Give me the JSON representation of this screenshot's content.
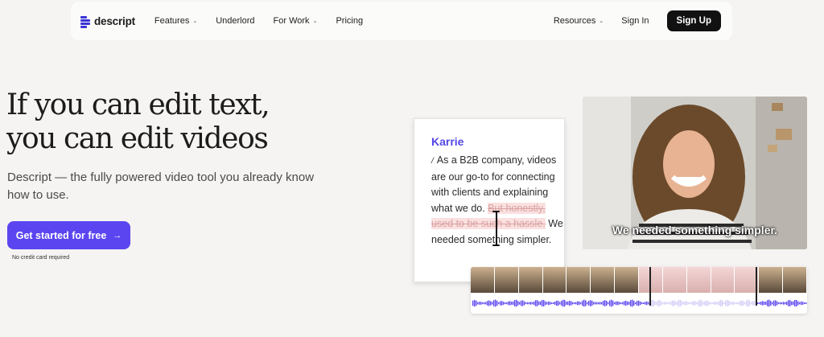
{
  "nav": {
    "brand": "descript",
    "left_items": [
      {
        "label": "Features",
        "dropdown": true
      },
      {
        "label": "Underlord",
        "dropdown": false
      },
      {
        "label": "For Work",
        "dropdown": true
      },
      {
        "label": "Pricing",
        "dropdown": false
      }
    ],
    "resources_label": "Resources",
    "signin_label": "Sign In",
    "signup_label": "Sign Up"
  },
  "hero": {
    "headline_line1": "If you can edit text,",
    "headline_line2": "you can edit videos",
    "subtext": "Descript — the fully powered video tool you already know how to use.",
    "cta_label": "Get started for free",
    "cta_arrow": "→",
    "note": "No credit card required"
  },
  "transcript": {
    "speaker": "Karrie",
    "marker": "/",
    "text_before": "As a B2B company, videos are our go-to for connecting with clients and explaining what we do.",
    "strikethrough": "But honestly, used to be such a hassle.",
    "text_after": "We needed something simpler."
  },
  "video": {
    "caption": "We needed something simpler."
  },
  "colors": {
    "accent": "#5b45f0",
    "speaker": "#5346e6",
    "signup_bg": "#111111",
    "waveform": "#5b45f0",
    "waveform_muted": "#d6cdf7"
  },
  "icons": {
    "chevron": "chevron-down-icon",
    "cta_arrow": "arrow-right-icon",
    "text_cursor": "text-cursor-icon"
  }
}
